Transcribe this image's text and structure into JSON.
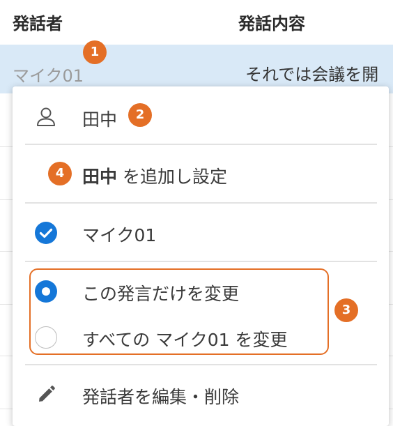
{
  "table": {
    "header_speaker": "発話者",
    "header_content": "発話内容",
    "selected_row": {
      "speaker": "マイク01",
      "content": "それでは会議を開"
    }
  },
  "menu": {
    "assign_user": {
      "label": "田中",
      "icon": "person-icon"
    },
    "add_and_set": {
      "bold": "田中",
      "rest": " を追加し設定"
    },
    "current_speaker": {
      "label": "マイク01",
      "icon": "check-circle-icon",
      "checked": true
    },
    "scope_options": [
      {
        "label": "この発言だけを変更",
        "selected": true
      },
      {
        "label": "すべての マイク01 を変更",
        "selected": false
      }
    ],
    "edit_delete": {
      "label": "発話者を編集・削除",
      "icon": "pencil-icon"
    }
  },
  "callouts": [
    "1",
    "2",
    "3",
    "4"
  ],
  "colors": {
    "accent_blue": "#1577d8",
    "callout_orange": "#e46f26",
    "selected_row_bg": "#d9e9f7"
  }
}
